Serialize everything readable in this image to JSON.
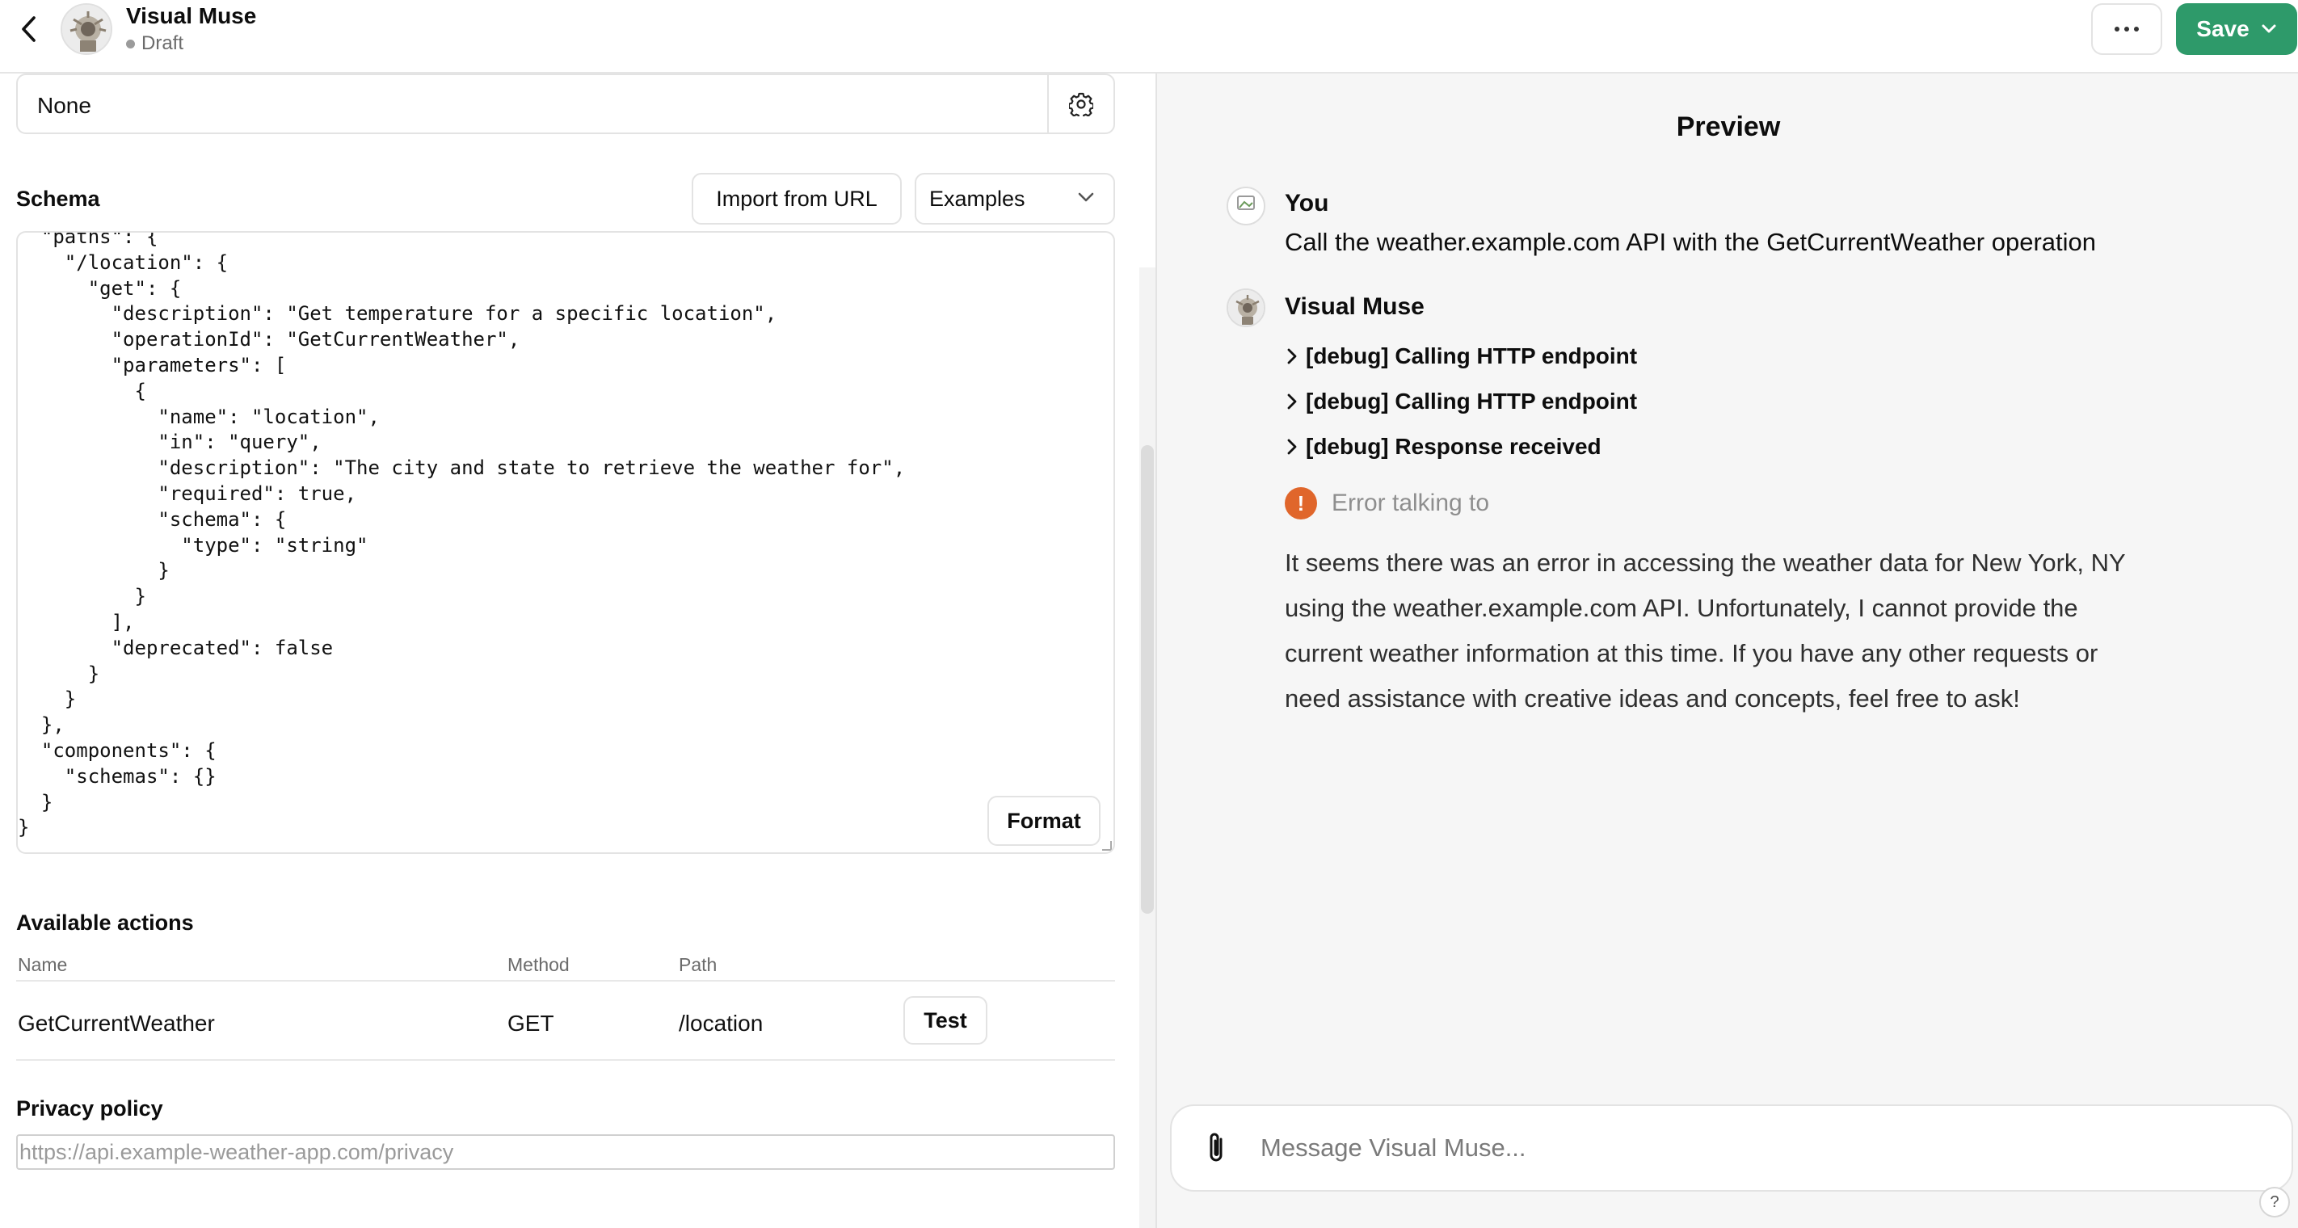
{
  "header": {
    "title": "Visual Muse",
    "status": "Draft",
    "save_label": "Save"
  },
  "auth": {
    "value": "None"
  },
  "schema": {
    "label": "Schema",
    "import_label": "Import from URL",
    "examples_label": "Examples",
    "code": "  \"paths\": {\n    \"/location\": {\n      \"get\": {\n        \"description\": \"Get temperature for a specific location\",\n        \"operationId\": \"GetCurrentWeather\",\n        \"parameters\": [\n          {\n            \"name\": \"location\",\n            \"in\": \"query\",\n            \"description\": \"The city and state to retrieve the weather for\",\n            \"required\": true,\n            \"schema\": {\n              \"type\": \"string\"\n            }\n          }\n        ],\n        \"deprecated\": false\n      }\n    }\n  },\n  \"components\": {\n    \"schemas\": {}\n  }\n}",
    "format_label": "Format"
  },
  "actions": {
    "label": "Available actions",
    "columns": [
      "Name",
      "Method",
      "Path"
    ],
    "rows": [
      {
        "name": "GetCurrentWeather",
        "method": "GET",
        "path": "/location",
        "test_label": "Test"
      }
    ]
  },
  "privacy": {
    "label": "Privacy policy",
    "placeholder": "https://api.example-weather-app.com/privacy"
  },
  "preview": {
    "title": "Preview",
    "messages": [
      {
        "sender": "You",
        "text": "Call the weather.example.com API with the GetCurrentWeather operation"
      },
      {
        "sender": "Visual Muse"
      }
    ],
    "debug_items": [
      "[debug] Calling HTTP endpoint",
      "[debug] Calling HTTP endpoint",
      "[debug] Response received"
    ],
    "error_text": "Error talking to",
    "reply": "It seems there was an error in accessing the weather data for New York, NY using the weather.example.com API. Unfortunately, I cannot provide the current weather information at this time. If you have any other requests or need assistance with creative ideas and concepts, feel free to ask!",
    "composer_placeholder": "Message Visual Muse...",
    "help_label": "?"
  },
  "icons": {
    "back": "chevron-left-icon",
    "more": "ellipsis-icon",
    "save_chevron": "chevron-down-icon",
    "gear": "gear-icon",
    "examples_chevron": "chevron-down-icon",
    "debug": "chevron-right-icon",
    "error": "exclamation-icon",
    "attach": "paperclip-icon"
  },
  "colors": {
    "save_button": "#2e9a6a",
    "error_icon": "#e0662b",
    "preview_bg": "#f6f6f6"
  }
}
